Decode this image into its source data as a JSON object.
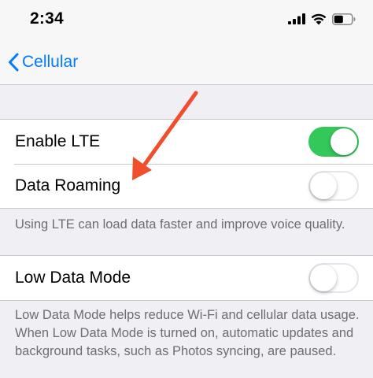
{
  "status_bar": {
    "time": "2:34"
  },
  "nav": {
    "back_label": "Cellular"
  },
  "group1": {
    "rows": [
      {
        "label": "Enable LTE",
        "toggle": "on"
      },
      {
        "label": "Data Roaming",
        "toggle": "off"
      }
    ],
    "footer": "Using LTE can load data faster and improve voice quality."
  },
  "group2": {
    "rows": [
      {
        "label": "Low Data Mode",
        "toggle": "off"
      }
    ],
    "footer": "Low Data Mode helps reduce Wi-Fi and cellular data usage. When Low Data Mode is turned on, automatic updates and background tasks, such as Photos syncing, are paused."
  },
  "colors": {
    "accent": "#007aff",
    "toggle_on": "#34c759",
    "annotation_arrow": "#f04e2c"
  },
  "icons": [
    "cellular-signal-icon",
    "wifi-icon",
    "battery-icon",
    "chevron-left-icon"
  ]
}
